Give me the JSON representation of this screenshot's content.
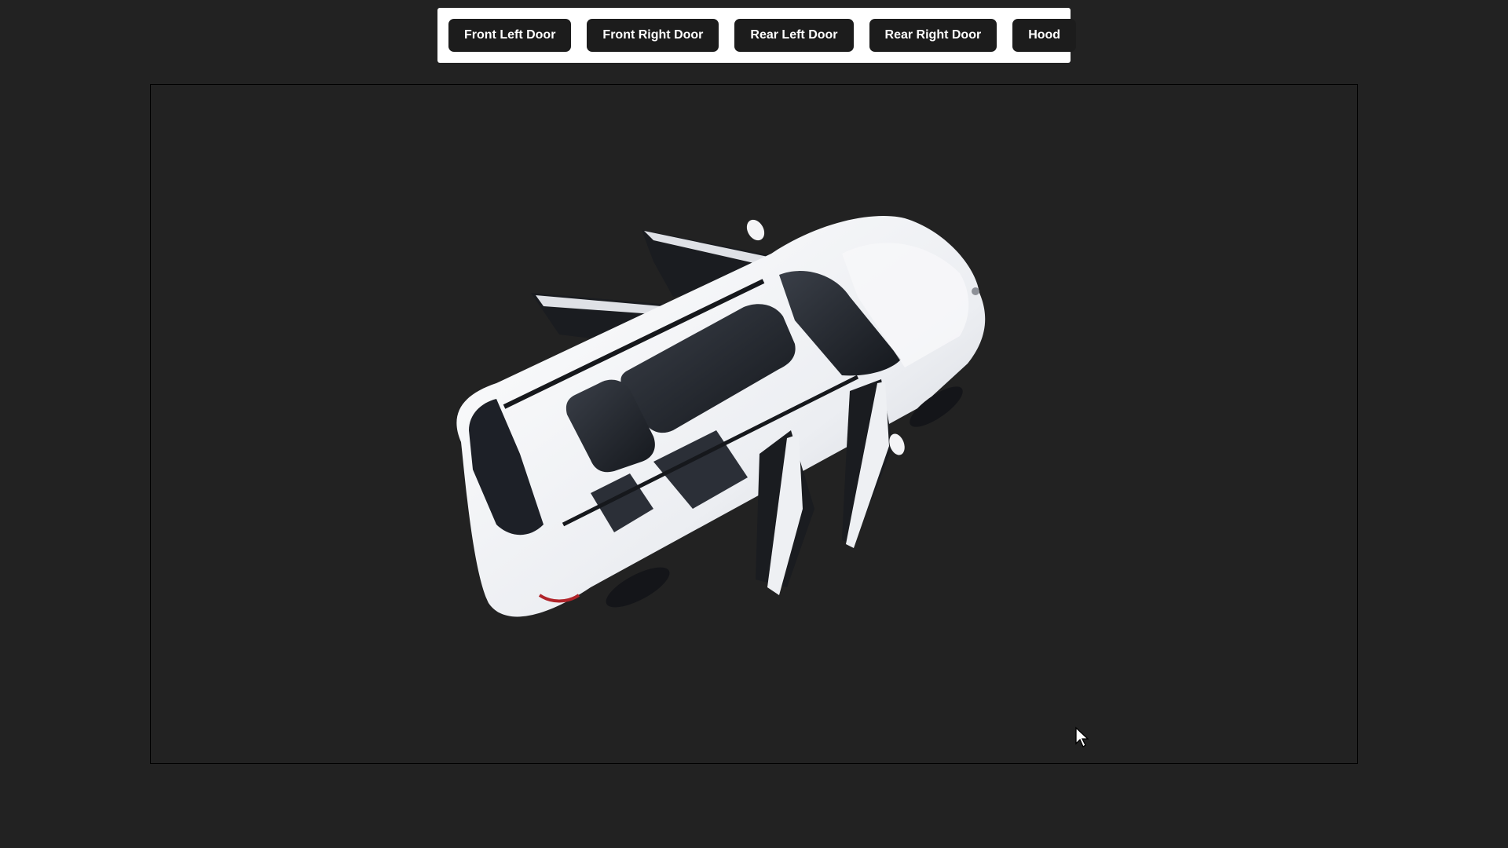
{
  "toolbar": {
    "buttons": [
      {
        "label": "Front Left Door"
      },
      {
        "label": "Front Right Door"
      },
      {
        "label": "Rear Left Door"
      },
      {
        "label": "Rear Right Door"
      },
      {
        "label": "Hood"
      }
    ]
  },
  "viewer": {
    "model_color": "#f2f2f4",
    "glass_color": "#2a2e36",
    "background_color": "#222222"
  },
  "icons": {
    "cursor": "mouse-pointer-icon"
  }
}
